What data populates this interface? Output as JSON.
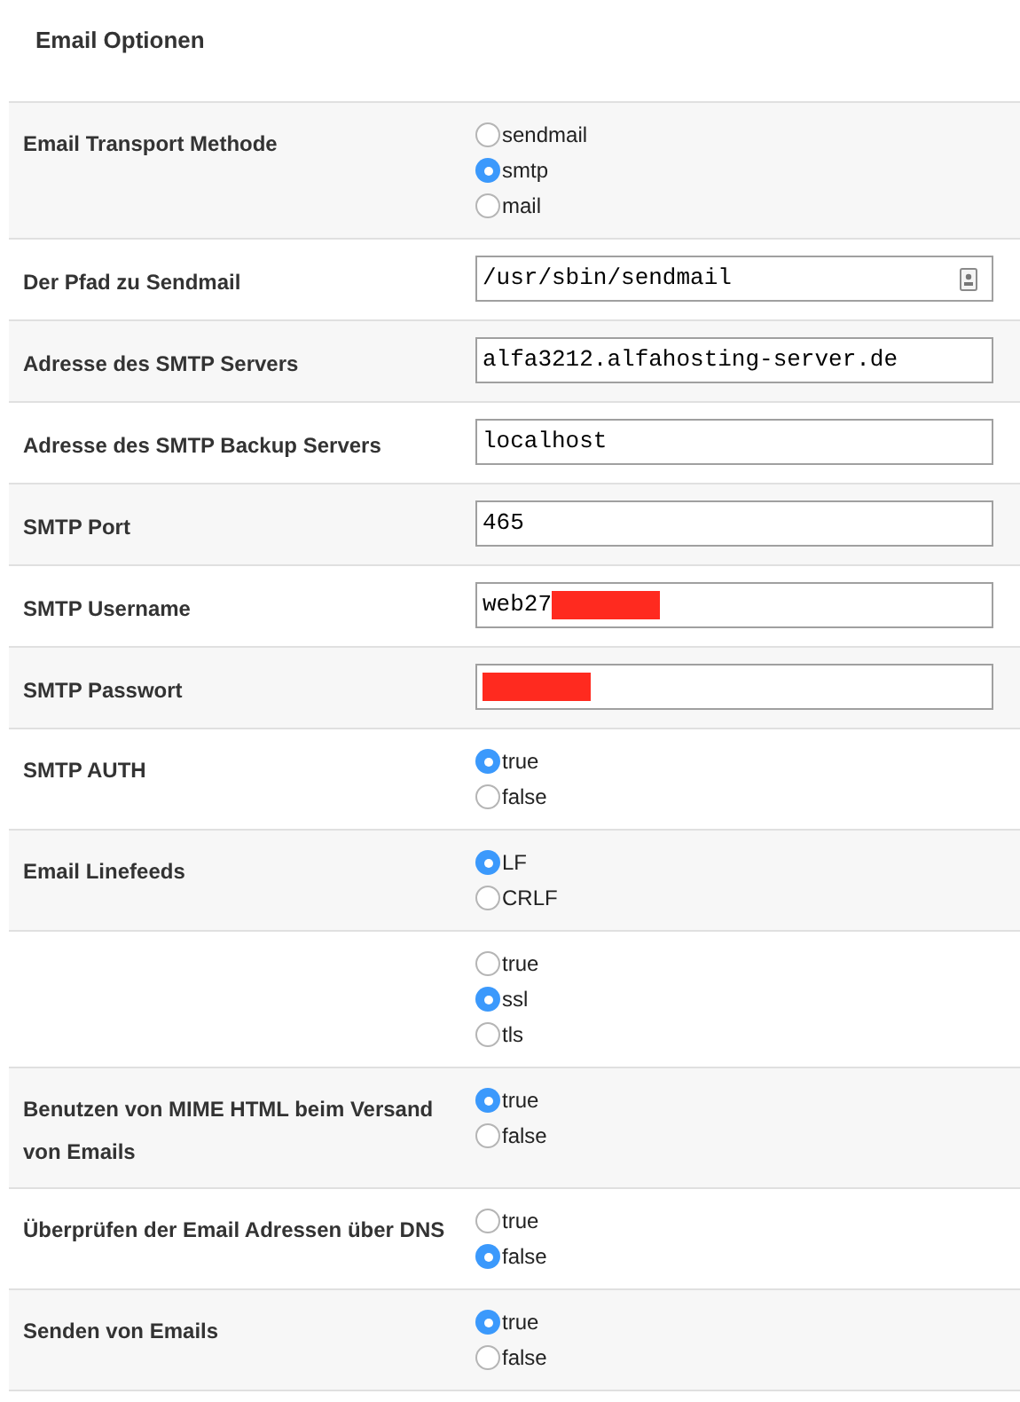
{
  "title": "Email Optionen",
  "rows": [
    {
      "kind": "radio",
      "label": "Email Transport Methode",
      "options": [
        {
          "label": "sendmail",
          "selected": false
        },
        {
          "label": "smtp",
          "selected": true
        },
        {
          "label": "mail",
          "selected": false
        }
      ]
    },
    {
      "kind": "text",
      "label": "Der Pfad zu Sendmail",
      "value": "/usr/sbin/sendmail",
      "autofill_icon": true
    },
    {
      "kind": "text",
      "label": "Adresse des SMTP Servers",
      "value": "alfa3212.alfahosting-server.de"
    },
    {
      "kind": "text",
      "label": "Adresse des SMTP Backup Servers",
      "value": "localhost"
    },
    {
      "kind": "text",
      "label": "SMTP Port",
      "value": "465"
    },
    {
      "kind": "text",
      "label": "SMTP Username",
      "value": "web27",
      "redacted": true
    },
    {
      "kind": "text",
      "label": "SMTP Passwort",
      "redacted": true
    },
    {
      "kind": "radio",
      "label": "SMTP AUTH",
      "options": [
        {
          "label": "true",
          "selected": true
        },
        {
          "label": "false",
          "selected": false
        }
      ]
    },
    {
      "kind": "radio",
      "label": "Email Linefeeds",
      "options": [
        {
          "label": "LF",
          "selected": true
        },
        {
          "label": "CRLF",
          "selected": false
        }
      ]
    },
    {
      "kind": "radio",
      "options": [
        {
          "label": "true",
          "selected": false
        },
        {
          "label": "ssl",
          "selected": true
        },
        {
          "label": "tls",
          "selected": false
        }
      ]
    },
    {
      "kind": "radio",
      "label": "Benutzen von MIME HTML beim Versand von Emails",
      "options": [
        {
          "label": "true",
          "selected": true
        },
        {
          "label": "false",
          "selected": false
        }
      ]
    },
    {
      "kind": "radio",
      "label": "Überprüfen der Email Adressen über DNS",
      "options": [
        {
          "label": "true",
          "selected": false
        },
        {
          "label": "false",
          "selected": true
        }
      ]
    },
    {
      "kind": "radio",
      "label": "Senden von Emails",
      "options": [
        {
          "label": "true",
          "selected": true
        },
        {
          "label": "false",
          "selected": false
        }
      ]
    }
  ]
}
